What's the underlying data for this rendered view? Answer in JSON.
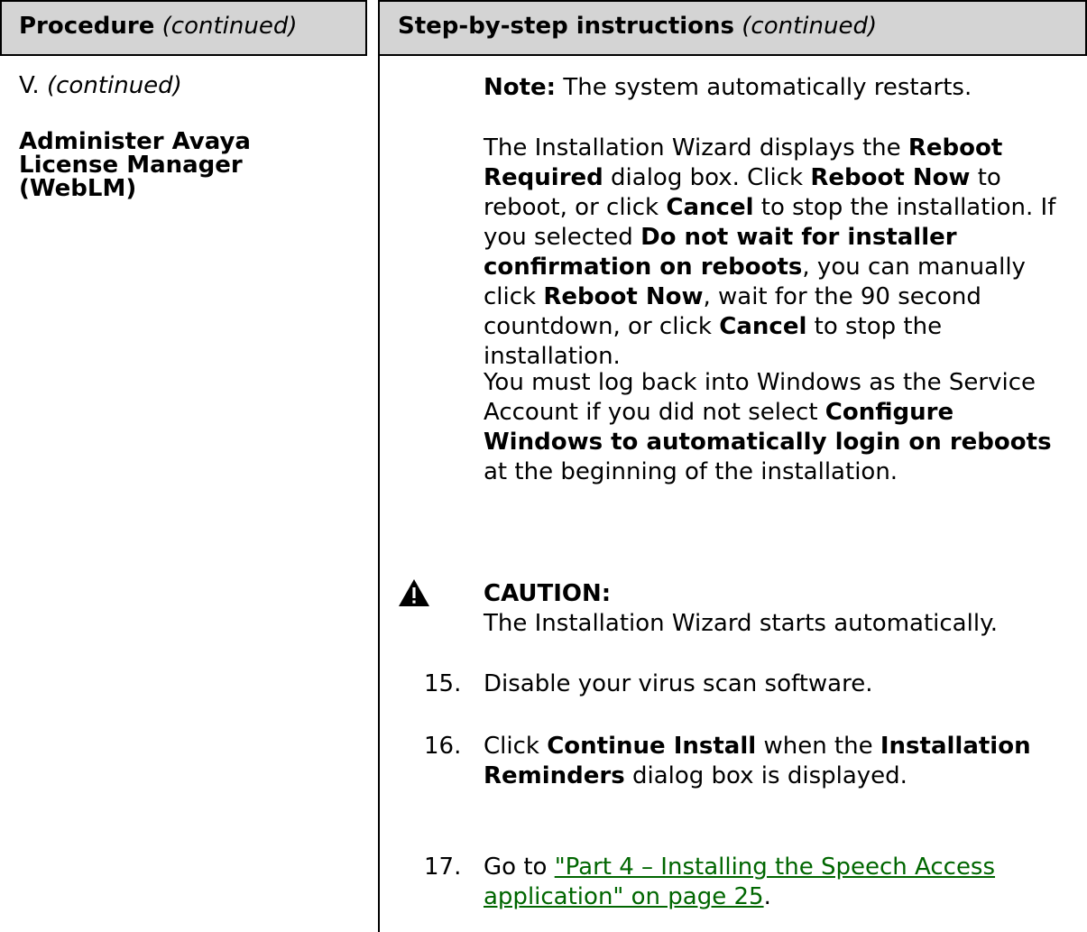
{
  "header": {
    "procedure_label": "Procedure",
    "procedure_note": "(continued)",
    "steps_label": "Step-by-step instructions",
    "steps_note": "(continued)"
  },
  "left": {
    "section_id": "V.",
    "section_note": "(continued)",
    "section_title_line1": "Administer Avaya",
    "section_title_line2": "License Manager",
    "section_title_line3": "(WebLM)"
  },
  "note": {
    "label": "Note:",
    "text": " The system automatically restarts."
  },
  "reboot_para": {
    "t1": "The Installation Wizard displays the ",
    "b1": "Reboot Required",
    "t2": " dialog box. Click ",
    "b2": "Reboot Now",
    "t3": " to reboot, or click ",
    "b3": "Cancel",
    "t4": " to stop the installation. If you selected ",
    "b4": "Do not wait for installer confirmation on reboots",
    "t5": ", you can manually click ",
    "b5": "Reboot Now",
    "t6": ", wait for the 90 second countdown, or click ",
    "b6": "Cancel",
    "t7": " to stop the installation."
  },
  "login_para": {
    "t1": "You must log back into Windows as the Service Account if you did not select ",
    "b1": "Configure Windows to automatically login on reboots",
    "t2": " at the beginning of the installation."
  },
  "caution": {
    "icon": "warning-triangle-icon",
    "label": "CAUTION:",
    "text": "The Installation Wizard starts automatically."
  },
  "steps": [
    {
      "num": "15.",
      "t1": "Disable your virus scan software."
    },
    {
      "num": "16.",
      "t1": "Click ",
      "b1": "Continue Install",
      "t2": " when the ",
      "b2": "Installation Reminders",
      "t3": " dialog box is displayed."
    },
    {
      "num": "17.",
      "t1": "Go to ",
      "link": "\"Part 4 – Installing the Speech Access application\" on page 25",
      "t2": "."
    }
  ],
  "colors": {
    "header_bg": "#d4d4d4",
    "link": "#006600"
  }
}
